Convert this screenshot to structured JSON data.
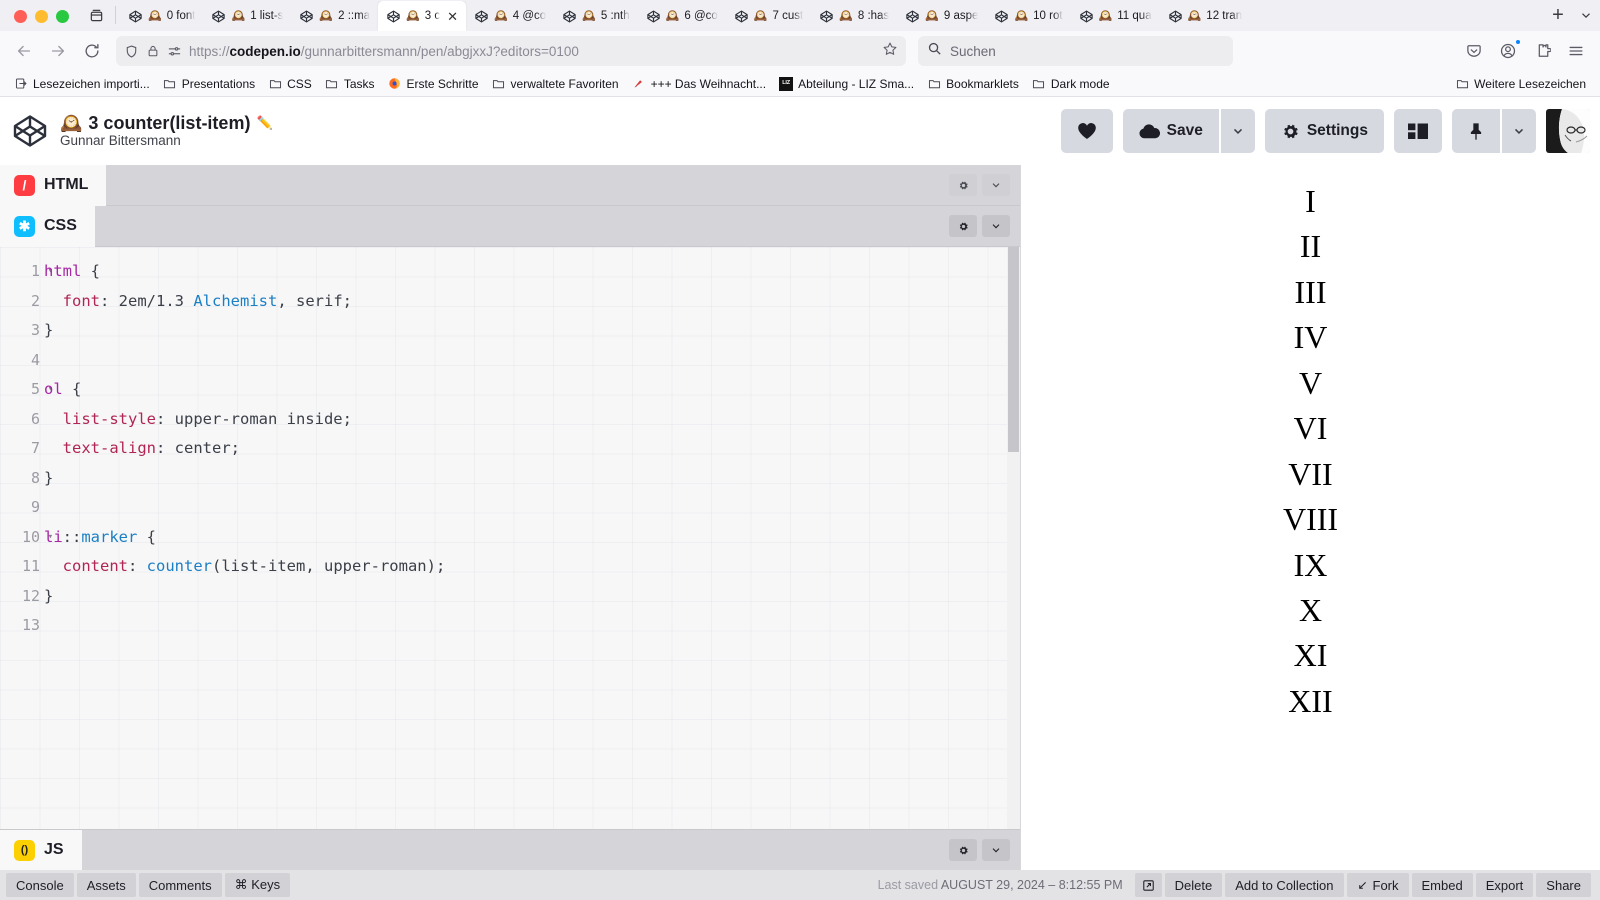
{
  "browser": {
    "window_controls": [
      "close",
      "minimize",
      "maximize"
    ],
    "list_all_tabs_title": "List all tabs",
    "tabs": [
      {
        "label": "0 font",
        "emoji": "🕰️",
        "active": false
      },
      {
        "label": "1 list-s",
        "emoji": "🕰️",
        "active": false
      },
      {
        "label": "2 ::ma",
        "emoji": "🕰️",
        "active": false
      },
      {
        "label": "3 c",
        "emoji": "🕰️",
        "active": true
      },
      {
        "label": "4 @co",
        "emoji": "🕰️",
        "active": false
      },
      {
        "label": "5 :nth",
        "emoji": "🕰️",
        "active": false
      },
      {
        "label": "6 @co",
        "emoji": "🕰️",
        "active": false
      },
      {
        "label": "7 cust",
        "emoji": "🕰️",
        "active": false
      },
      {
        "label": "8 :has",
        "emoji": "🕰️",
        "active": false
      },
      {
        "label": "9 aspe",
        "emoji": "🕰️",
        "active": false
      },
      {
        "label": "10 rot",
        "emoji": "🕰️",
        "active": false
      },
      {
        "label": "11 qua",
        "emoji": "🕰️",
        "active": false
      },
      {
        "label": "12 tran",
        "emoji": "🕰️",
        "active": false
      }
    ],
    "new_tab_label": "+",
    "url": {
      "scheme": "https://",
      "domain": "codepen.io",
      "path": "/gunnarbittersmann/pen/abgjxxJ?editors=0100"
    },
    "search_placeholder": "Suchen",
    "bookmarks": [
      {
        "label": "Lesezeichen importi...",
        "icon": "import-icon"
      },
      {
        "label": "Presentations",
        "icon": "folder-icon"
      },
      {
        "label": "CSS",
        "icon": "folder-icon"
      },
      {
        "label": "Tasks",
        "icon": "folder-icon"
      },
      {
        "label": "Erste Schritte",
        "icon": "firefox-icon"
      },
      {
        "label": "verwaltete Favoriten",
        "icon": "folder-icon"
      },
      {
        "label": "+++ Das Weihnacht...",
        "icon": "bookmark-pin-icon"
      },
      {
        "label": "Abteilung - LIZ Sma...",
        "icon": "liz-icon"
      },
      {
        "label": "Bookmarklets",
        "icon": "folder-icon"
      },
      {
        "label": "Dark mode",
        "icon": "folder-icon"
      }
    ],
    "bookmarks_overflow": {
      "label": "Weitere Lesezeichen",
      "icon": "folder-icon"
    }
  },
  "codepen": {
    "title": "3 counter(list-item)",
    "title_emoji": "🕰️",
    "author": "Gunnar Bittersmann",
    "actions": {
      "love": "",
      "save": "Save",
      "save_caret": "⌄",
      "settings": "Settings",
      "layout": "",
      "pin": "",
      "pin_caret": "⌄"
    },
    "panes": [
      {
        "name": "HTML",
        "icon_char": "/",
        "icon_class": "html"
      },
      {
        "name": "CSS",
        "icon_char": "✱",
        "icon_class": "css"
      },
      {
        "name": "JS",
        "icon_char": "()",
        "icon_class": "js"
      }
    ],
    "css_editor": {
      "line_numbers": [
        "1",
        "2",
        "3",
        "4",
        "5",
        "6",
        "7",
        "8",
        "9",
        "10",
        "11",
        "12",
        "13"
      ],
      "fold_lines": [
        1,
        5,
        10
      ],
      "lines": [
        "html {",
        "  font: 2em/1.3 Alchemist, serif;",
        "}",
        "",
        "ol {",
        "  list-style: upper-roman inside;",
        "  text-align: center;",
        "}",
        "",
        "li::marker {",
        "  content: counter(list-item, upper-roman);",
        "}",
        ""
      ]
    },
    "preview": {
      "items": [
        "I",
        "II",
        "III",
        "IV",
        "V",
        "VI",
        "VII",
        "VIII",
        "IX",
        "X",
        "XI",
        "XII"
      ]
    },
    "bottom_left": [
      "Console",
      "Assets",
      "Comments",
      "⌘ Keys"
    ],
    "last_saved_label": "Last saved",
    "last_saved_value": "AUGUST 29, 2024 – 8:12:55 PM",
    "bottom_right": [
      "Delete",
      "Add to Collection",
      "Fork",
      "Embed",
      "Export",
      "Share"
    ]
  },
  "colors": {
    "html_red": "#ff3c41",
    "css_blue": "#0ebeff",
    "js_yellow": "#fcd000",
    "accent_blue": "#0a84ff"
  }
}
